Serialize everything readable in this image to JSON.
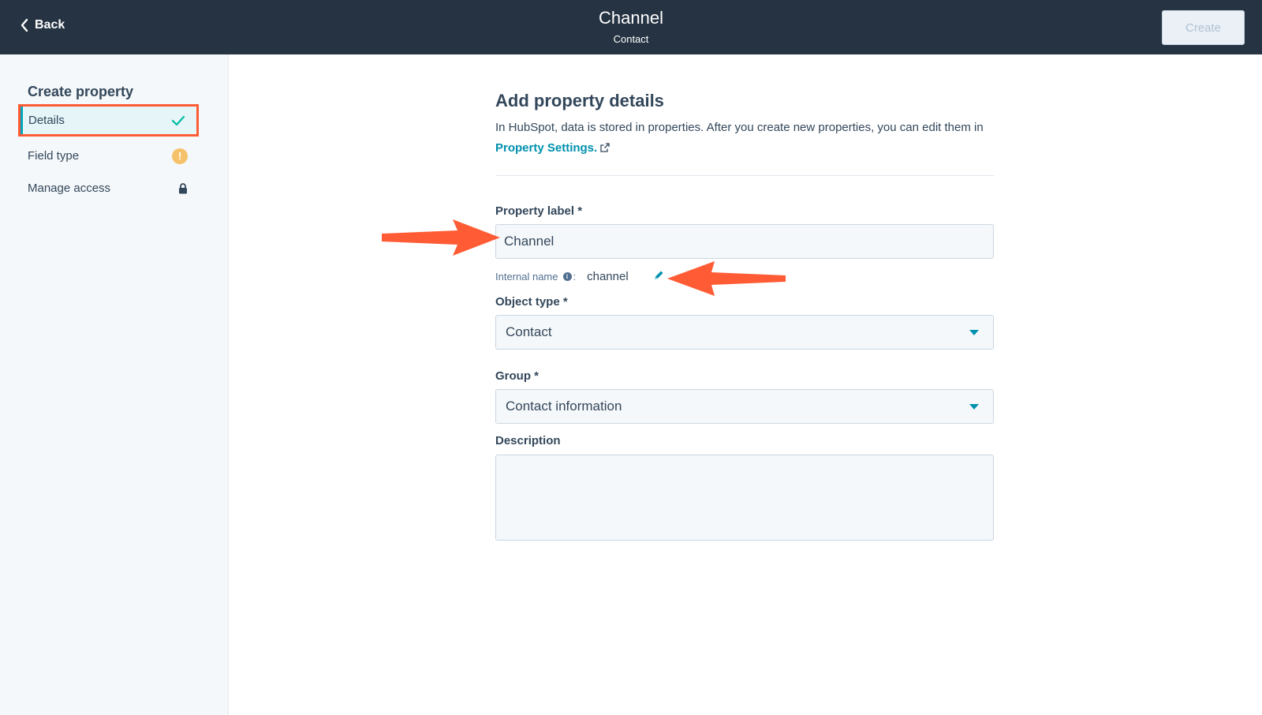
{
  "header": {
    "back_label": "Back",
    "title": "Channel",
    "subtitle": "Contact",
    "create_label": "Create"
  },
  "sidebar": {
    "heading": "Create property",
    "items": [
      {
        "label": "Details",
        "status": "complete"
      },
      {
        "label": "Field type",
        "status": "warning",
        "badge": "!"
      },
      {
        "label": "Manage access",
        "status": "locked"
      }
    ]
  },
  "main": {
    "title": "Add property details",
    "desc_prefix": "In HubSpot, data is stored in properties. After you create new properties, you can edit them in",
    "desc_link": "Property Settings.",
    "fields": {
      "property_label": {
        "label": "Property label *",
        "value": "Channel"
      },
      "internal_name": {
        "label": "Internal name",
        "info": "i",
        "colon": ":",
        "value": "channel"
      },
      "object_type": {
        "label": "Object type *",
        "value": "Contact"
      },
      "group": {
        "label": "Group *",
        "value": "Contact information"
      },
      "description": {
        "label": "Description",
        "value": ""
      }
    }
  },
  "colors": {
    "topbar": "#253342",
    "accent": "#0091ae",
    "highlight": "#ff5c35",
    "warning": "#f5c26b",
    "success": "#00bda5"
  },
  "icons": {
    "back": "chevron-left-icon",
    "complete": "check-icon",
    "warning": "warning-icon",
    "locked": "lock-icon",
    "external": "external-link-icon",
    "edit": "pencil-icon",
    "dropdown": "caret-down-icon",
    "annotation": "arrow-icon"
  }
}
